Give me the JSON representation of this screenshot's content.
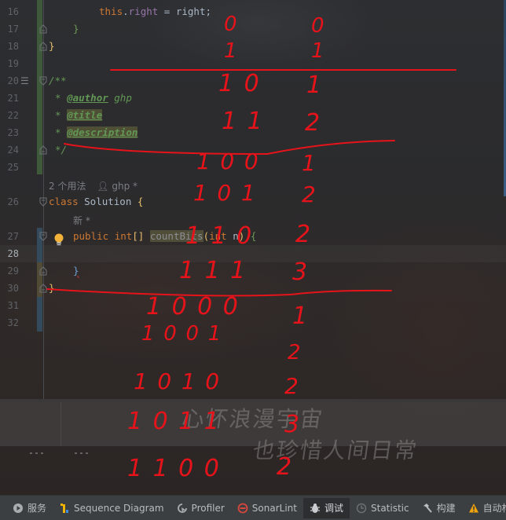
{
  "editor": {
    "line_numbers": [
      "16",
      "17",
      "18",
      "19",
      "20",
      "21",
      "22",
      "23",
      "24",
      "25",
      "26",
      "27",
      "28",
      "29",
      "30",
      "31",
      "32"
    ],
    "current_line": "28",
    "lines": {
      "l16": {
        "kw": "this",
        "dot": ".",
        "field": "right",
        "rest": " = right;"
      },
      "l17": "}",
      "l18": "}",
      "l20": "/**",
      "l21_star": "* ",
      "l21_tag": "@author",
      "l21_val": " ghp",
      "l22_star": "* ",
      "l22_tag": "@title",
      "l23_star": "* ",
      "l23_tag": "@description",
      "l24": "*/",
      "l26_kw": "class ",
      "l26_name": "Solution ",
      "l26_brace": "{",
      "l27_kw1": "public ",
      "l27_kw2": "int",
      "l27_br": "[] ",
      "l27_fn": "countBits",
      "l27_p1": "(",
      "l27_kw3": "int ",
      "l27_param": "n",
      "l27_p2": ") ",
      "l27_brace": "{",
      "l29": "}",
      "l30": "}"
    },
    "inlays": {
      "usages": "2 个用法",
      "author": "ghp *",
      "new_marker": "新 *"
    }
  },
  "annotations": {
    "color": "#e6141a",
    "binary_table": [
      {
        "binary": "0",
        "ones": "0"
      },
      {
        "binary": "1",
        "ones": "1"
      },
      {
        "binary": "10",
        "ones": "1"
      },
      {
        "binary": "11",
        "ones": "2"
      },
      {
        "binary": "100",
        "ones": "1"
      },
      {
        "binary": "101",
        "ones": "2"
      },
      {
        "binary": "110",
        "ones": "2"
      },
      {
        "binary": "111",
        "ones": "3"
      },
      {
        "binary": "1000",
        "ones": "1"
      },
      {
        "binary": "1001",
        "ones": "2"
      },
      {
        "binary": "1010",
        "ones": "2"
      },
      {
        "binary": "1011",
        "ones": "3"
      },
      {
        "binary": "1100",
        "ones": "2"
      }
    ]
  },
  "watermark": {
    "line1": "心怀浪漫宇宙",
    "line2": "也珍惜人间日常"
  },
  "toolbar": {
    "items": [
      {
        "label": "服务",
        "icon": "play-circle-icon"
      },
      {
        "label": "Sequence Diagram",
        "icon": "sequence-diagram-icon"
      },
      {
        "label": "Profiler",
        "icon": "profiler-icon"
      },
      {
        "label": "SonarLint",
        "icon": "sonarlint-icon"
      },
      {
        "label": "调试",
        "icon": "bug-icon",
        "active": true
      },
      {
        "label": "Statistic",
        "icon": "statistic-icon"
      },
      {
        "label": "构建",
        "icon": "hammer-icon"
      },
      {
        "label": "自动构建",
        "icon": "warning-icon"
      }
    ],
    "colors": {
      "sonarlint": "#d9463e",
      "sequence_yellow": "#f0b400",
      "sequence_blue": "#3c8fe0",
      "warning": "#f0a30a"
    }
  }
}
